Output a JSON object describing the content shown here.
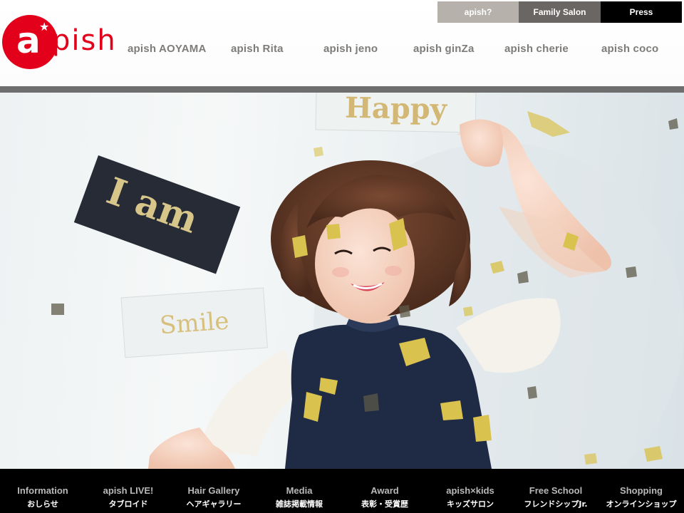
{
  "brand": {
    "logo_letter": "a",
    "logo_rest": "pish",
    "colors": {
      "brand_red": "#e2001a",
      "nav_text": "#7e7c79",
      "footer_bg": "#000000"
    }
  },
  "topbar": [
    {
      "label": "apish?"
    },
    {
      "label": "Family Salon"
    },
    {
      "label": "Press"
    }
  ],
  "nav": [
    {
      "label": "apish AOYAMA"
    },
    {
      "label": "apish Rita"
    },
    {
      "label": "apish jeno"
    },
    {
      "label": "apish ginZa"
    },
    {
      "label": "apish cherie"
    },
    {
      "label": "apish coco"
    }
  ],
  "hero": {
    "card_1": "I am",
    "card_2": "Happy",
    "card_3": "Smile"
  },
  "footer": [
    {
      "en": "Information",
      "jp": "おしらせ"
    },
    {
      "en": "apish LIVE!",
      "jp": "タブロイド"
    },
    {
      "en": "Hair Gallery",
      "jp": "ヘアギャラリー"
    },
    {
      "en": "Media",
      "jp": "雑誌掲載情報"
    },
    {
      "en": "Award",
      "jp": "表彰・受賞歴"
    },
    {
      "en": "apish×kids",
      "jp": "キッズサロン"
    },
    {
      "en": "Free School",
      "jp": "フレンドシップJr."
    },
    {
      "en": "Shopping",
      "jp": "オンラインショップ"
    }
  ]
}
